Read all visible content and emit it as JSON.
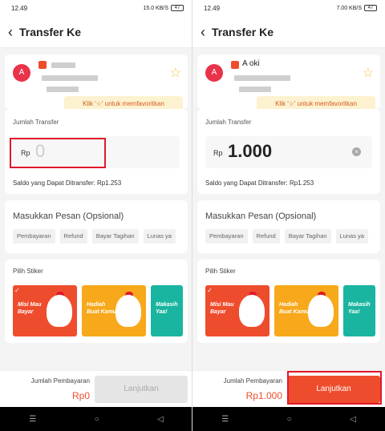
{
  "screens": [
    {
      "status": {
        "time": "12.49",
        "signal": "15.0 KB/S",
        "battery": "47"
      },
      "header": {
        "title": "Transfer Ke"
      },
      "recipient": {
        "avatar": "A",
        "name": ""
      },
      "tooltip": "Klik '☆' untuk memfavoritkan",
      "amount": {
        "label": "Jumlah Transfer",
        "currency": "Rp",
        "value": "0",
        "saldo": "Saldo yang Dapat Ditransfer: Rp1.253"
      },
      "message": {
        "placeholder": "Masukkan Pesan (Opsional)",
        "chips": [
          "Pembayaran",
          "Refund",
          "Bayar Tagihan",
          "Lunas ya"
        ]
      },
      "stiker": {
        "title": "Pilih Stiker",
        "items": [
          "Misi Mau Bayar",
          "Hadiah Buat Kamu",
          "Makasih Yaa!"
        ]
      },
      "footer": {
        "label": "Jumlah Pembayaran",
        "total": "Rp0",
        "button": "Lanjutkan"
      }
    },
    {
      "status": {
        "time": "12.49",
        "signal": "7.00 KB/S",
        "battery": "47"
      },
      "header": {
        "title": "Transfer Ke"
      },
      "recipient": {
        "avatar": "A",
        "name": "A   oki"
      },
      "tooltip": "Klik '☆' untuk memfavoritkan",
      "amount": {
        "label": "Jumlah Transfer",
        "currency": "Rp",
        "value": "1.000",
        "saldo": "Saldo yang Dapat Ditransfer: Rp1.253"
      },
      "message": {
        "placeholder": "Masukkan Pesan (Opsional)",
        "chips": [
          "Pembayaran",
          "Refund",
          "Bayar Tagihan",
          "Lunas ya"
        ]
      },
      "stiker": {
        "title": "Pilih Stiker",
        "items": [
          "Misi Mau Bayar",
          "Hadiah Buat Kamu",
          "Makasih Yaa!"
        ]
      },
      "footer": {
        "label": "Jumlah Pembayaran",
        "total": "Rp1.000",
        "button": "Lanjutkan"
      }
    }
  ],
  "colors": {
    "accent": "#ee4d2d",
    "highlight": "#e0192a"
  }
}
